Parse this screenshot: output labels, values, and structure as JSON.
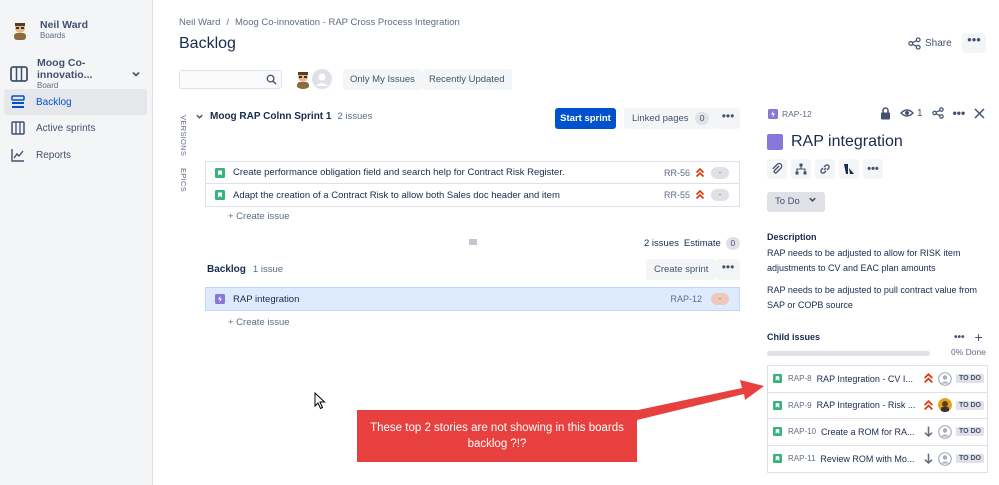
{
  "sidebar": {
    "user": {
      "name": "Neil Ward",
      "subtitle": "Boards"
    },
    "project": {
      "name": "Moog Co-innovatio...",
      "subtitle": "Board"
    },
    "items": [
      {
        "label": "Backlog"
      },
      {
        "label": "Active sprints"
      },
      {
        "label": "Reports"
      }
    ]
  },
  "header": {
    "breadcrumb": [
      "Neil Ward",
      "/",
      "Moog Co-innovation - RAP Cross Process Integration"
    ],
    "title": "Backlog",
    "share_label": "Share",
    "more_label": "•••"
  },
  "filters": {
    "search_placeholder": "",
    "only_my_issues": "Only My Issues",
    "recently_updated": "Recently Updated"
  },
  "side_labels": {
    "versions": "VERSIONS",
    "epics": "EPICS"
  },
  "sprint": {
    "name": "Moog RAP Colnn Sprint 1",
    "count": "2 issues",
    "start_label": "Start sprint",
    "linked_label": "Linked pages",
    "linked_count": "0",
    "more_label": "•••",
    "issues": [
      {
        "summary": "Create performance obligation field and search help for Contract Risk Register.",
        "key": "RR-56",
        "estimate": "-"
      },
      {
        "summary": "Adapt the creation of a Contract Risk to allow both Sales doc header and item",
        "key": "RR-55",
        "estimate": "-"
      }
    ],
    "create_label": "+  Create issue",
    "footer_count": "2 issues",
    "estimate_label": "Estimate",
    "estimate_value": "0"
  },
  "backlog": {
    "name": "Backlog",
    "count": "1 issue",
    "create_sprint": "Create sprint",
    "more_label": "•••",
    "issues": [
      {
        "summary": "RAP integration",
        "key": "RAP-12",
        "estimate": "-"
      }
    ],
    "create_label": "+  Create issue"
  },
  "detail": {
    "key": "RAP-12",
    "watch_count": "1",
    "title": "RAP integration",
    "status": "To Do",
    "description_label": "Description",
    "description": [
      "RAP needs to be adjusted to allow for RISK item adjustments to CV and EAC plan amounts",
      "RAP needs to be adjusted to pull contract value from SAP or COPB source"
    ],
    "child_label": "Child issues",
    "progress_label": "0% Done",
    "progress": 0,
    "children": [
      {
        "key": "RAP-8",
        "summary": "RAP Integration - CV I...",
        "status": "TO DO"
      },
      {
        "key": "RAP-9",
        "summary": "RAP Integration - Risk ...",
        "status": "TO DO"
      },
      {
        "key": "RAP-10",
        "summary": "Create a ROM for RA...",
        "status": "TO DO"
      },
      {
        "key": "RAP-11",
        "summary": "Review ROM with Mo...",
        "status": "TO DO"
      }
    ]
  },
  "annotation": {
    "text": "These top 2 stories are not showing in this boards backlog ?!?",
    "color": "#e8403f"
  },
  "colors": {
    "accent": "#0052cc",
    "story_green": "#36b37e",
    "epic_purple": "#8777d9",
    "priority_red": "#de350b"
  }
}
